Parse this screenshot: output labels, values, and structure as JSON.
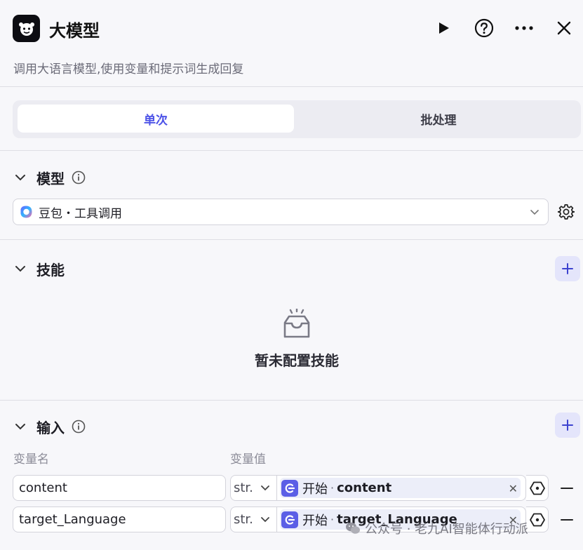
{
  "header": {
    "title": "大模型",
    "description": "调用大语言模型,使用变量和提示词生成回复",
    "icons": [
      "bot-icon",
      "run-icon",
      "help-icon",
      "more-icon",
      "close-icon"
    ]
  },
  "tabs": [
    {
      "label": "单次",
      "active": true
    },
    {
      "label": "批处理",
      "active": false
    }
  ],
  "model_section": {
    "title": "模型",
    "selected_model": "豆包・工具调用"
  },
  "skills_section": {
    "title": "技能",
    "empty_text": "暂未配置技能"
  },
  "input_section": {
    "title": "输入",
    "col_name": "变量名",
    "col_value": "变量值",
    "rows": [
      {
        "name": "content",
        "type": "str.",
        "ref_node": "开始",
        "ref_var": "content"
      },
      {
        "name": "target_Language",
        "type": "str.",
        "ref_node": "开始",
        "ref_var": "target_Language"
      }
    ]
  },
  "watermark": "公众号 · 老九AI智能体行动派",
  "colors": {
    "accent": "#4d53e8",
    "accent_bg": "#e4e5fb",
    "ref_icon": "#5b5fe6",
    "panel_bg": "#f7f7fa"
  }
}
